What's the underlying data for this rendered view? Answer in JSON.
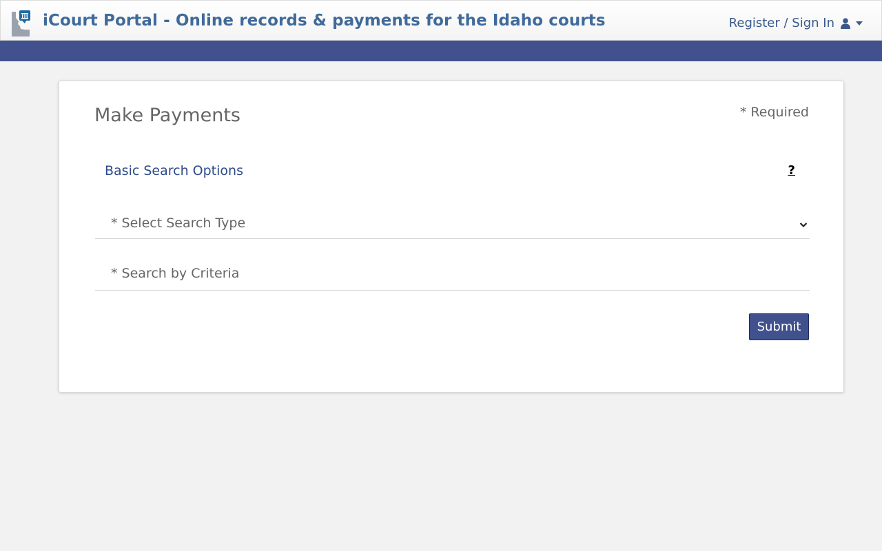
{
  "header": {
    "brand_title": "iCourt Portal - Online records & payments for the Idaho courts",
    "signin_label": "Register / Sign In",
    "logo_icon": "idaho-courthouse-logo-icon",
    "user_icon": "user-icon",
    "caret_icon": "caret-down-icon"
  },
  "colors": {
    "brand_text": "#3f6a9a",
    "navbar": "#41518d",
    "button": "#41518d",
    "page_background": "#f2f2f2"
  },
  "form": {
    "title": "Make Payments",
    "required_note": "* Required",
    "section_label": "Basic Search Options",
    "help_label": "?",
    "search_type_label": "* Select Search Type",
    "search_criteria_label": "* Search by Criteria",
    "submit_label": "Submit"
  }
}
